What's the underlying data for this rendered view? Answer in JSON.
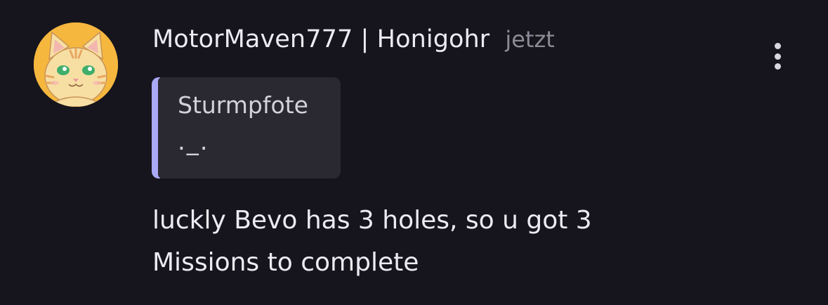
{
  "comment": {
    "author": "MotorMaven777 | Honigohr",
    "timestamp": "jetzt",
    "avatar_icon": "cat-avatar-icon",
    "menu_icon": "more-vertical-icon",
    "quote": {
      "author": "Sturmpfote",
      "text": "._."
    },
    "message_lines": [
      "luckly Bevo has 3 holes, so u got 3",
      "Missions to complete"
    ]
  },
  "colors": {
    "background": "#16151d",
    "quote_background": "#2a2932",
    "quote_accent": "#a9a9f7",
    "avatar_background": "#f6b73f"
  }
}
